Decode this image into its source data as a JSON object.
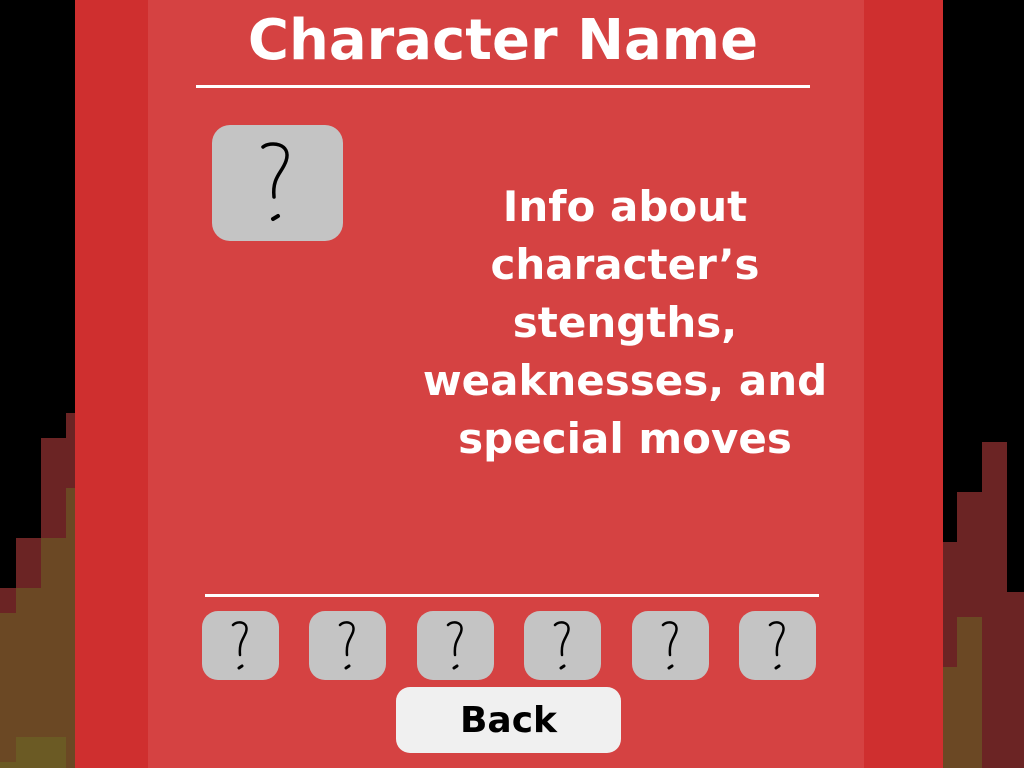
{
  "character": {
    "name": "Character Name",
    "portrait_icon": "question-mark-icon",
    "info": "Info about\ncharacter’s\nstengths,\nweaknesses, and\nspecial moves"
  },
  "slots": [
    {
      "icon": "question-mark-icon"
    },
    {
      "icon": "question-mark-icon"
    },
    {
      "icon": "question-mark-icon"
    },
    {
      "icon": "question-mark-icon"
    },
    {
      "icon": "question-mark-icon"
    },
    {
      "icon": "question-mark-icon"
    }
  ],
  "back_label": "Back",
  "colors": {
    "panel_outer": "#cf2f2f",
    "panel_inner": "#d54242",
    "tile": "#c4c4c4",
    "fire_dark": "#6b2424",
    "fire_mid": "#6b4824",
    "fire_light": "#6b5a24"
  }
}
